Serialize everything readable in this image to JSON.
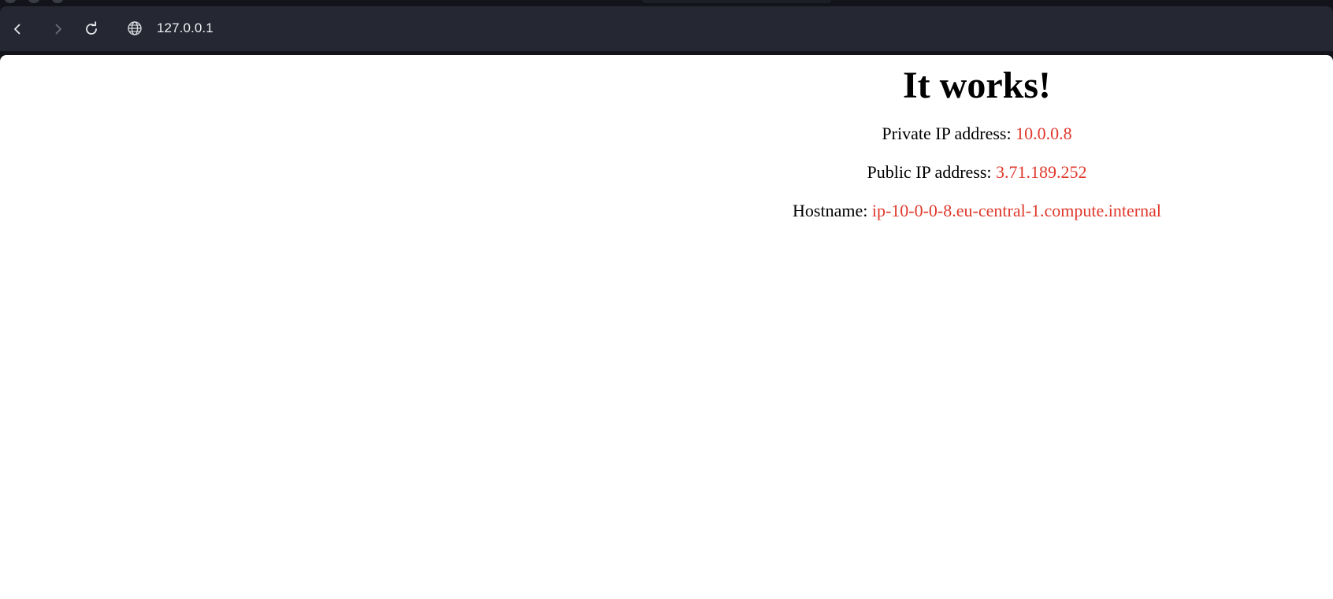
{
  "browser": {
    "address_bar": {
      "url": "127.0.0.1"
    },
    "icons": {
      "back": "chevron-left-icon",
      "forward": "chevron-right-icon",
      "reload": "reload-icon",
      "site": "globe-icon"
    },
    "colors": {
      "toolbar_bg": "#252732",
      "frame_bg": "#13141b",
      "text": "#eef0f4"
    }
  },
  "page": {
    "heading": "It works!",
    "private_ip": {
      "label": "Private IP address:",
      "value": "10.0.0.8"
    },
    "public_ip": {
      "label": "Public IP address:",
      "value": "3.71.189.252"
    },
    "hostname": {
      "label": "Hostname:",
      "value": "ip-10-0-0-8.eu-central-1.compute.internal"
    },
    "colors": {
      "text": "#000000",
      "value": "#e0382b",
      "background": "#ffffff"
    }
  }
}
